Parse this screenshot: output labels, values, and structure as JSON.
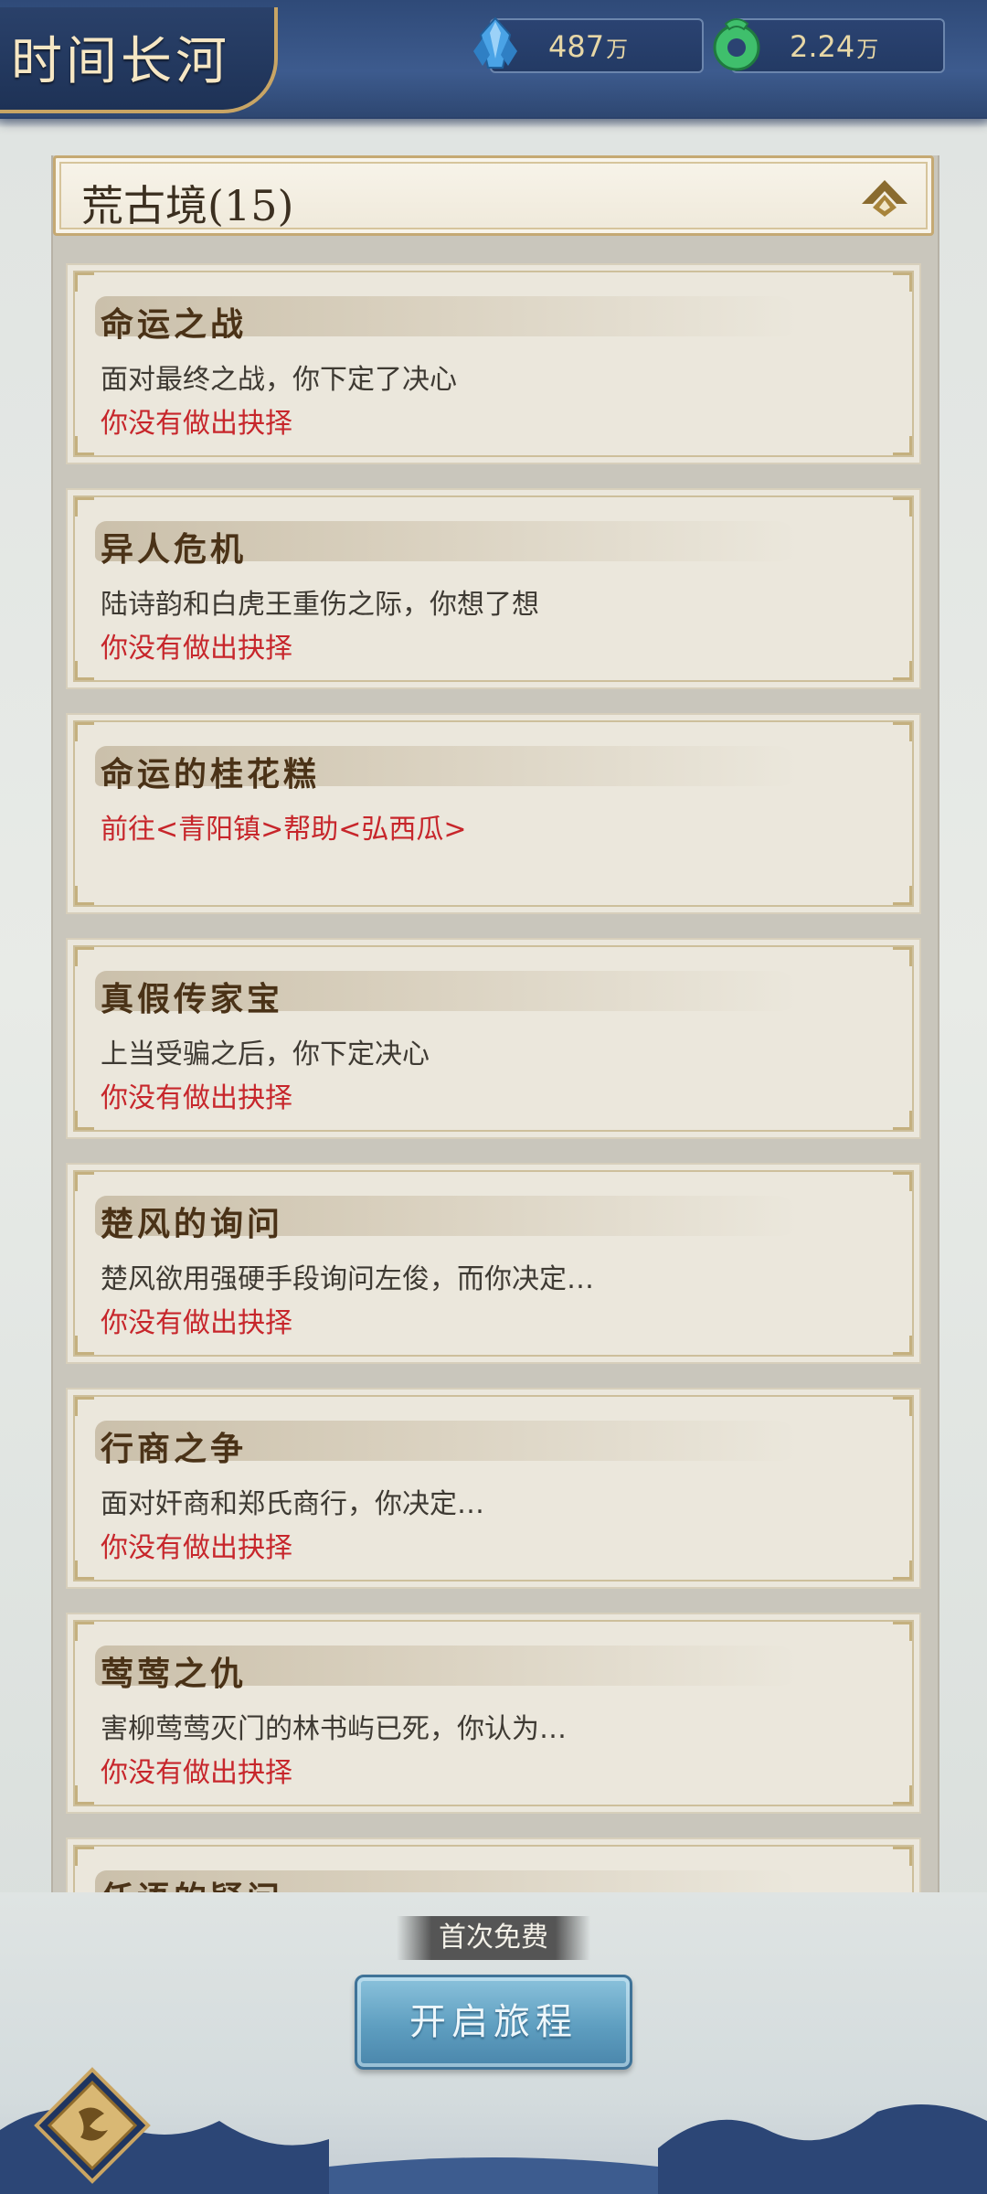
{
  "header": {
    "title": "时间长河",
    "currencies": [
      {
        "icon": "blue-crystal-icon",
        "value": "487",
        "unit": "万"
      },
      {
        "icon": "jade-coin-icon",
        "value": "2.24",
        "unit": "万"
      }
    ]
  },
  "section": {
    "title": "荒古境(15)",
    "collapse_icon": "chevron-up-icon"
  },
  "events": [
    {
      "title": "命运之战",
      "desc": "面对最终之战，你下定了决心",
      "status": "你没有做出抉择"
    },
    {
      "title": "异人危机",
      "desc": "陆诗韵和白虎王重伤之际，你想了想",
      "status": "你没有做出抉择"
    },
    {
      "title": "命运的桂花糕",
      "desc": "",
      "status": "前往<青阳镇>帮助<弘西瓜>"
    },
    {
      "title": "真假传家宝",
      "desc": "上当受骗之后，你下定决心",
      "status": "你没有做出抉择"
    },
    {
      "title": "楚风的询问",
      "desc": "楚风欲用强硬手段询问左俊，而你决定…",
      "status": "你没有做出抉择"
    },
    {
      "title": "行商之争",
      "desc": "面对奸商和郑氏商行，你决定…",
      "status": "你没有做出抉择"
    },
    {
      "title": "莺莺之仇",
      "desc": "害柳莺莺灭门的林书屿已死，你认为…",
      "status": "你没有做出抉择"
    },
    {
      "title": "任语的疑问",
      "desc": "",
      "status": ""
    }
  ],
  "footer": {
    "free_label": "首次免费",
    "start_button": "开启旅程",
    "menu_icon": "diamond-menu-icon"
  },
  "colors": {
    "header_blue": "#2f4a78",
    "gold": "#c8a565",
    "status_red": "#c7262b",
    "button_blue": "#5e9ec0"
  }
}
